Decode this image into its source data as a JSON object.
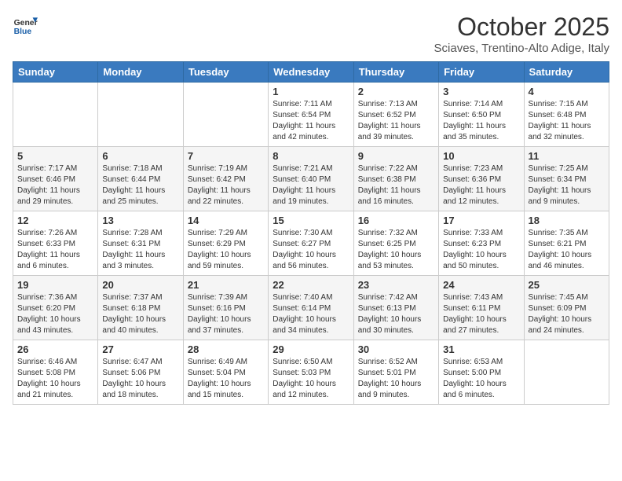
{
  "header": {
    "logo_line1": "General",
    "logo_line2": "Blue",
    "month": "October 2025",
    "location": "Sciaves, Trentino-Alto Adige, Italy"
  },
  "weekdays": [
    "Sunday",
    "Monday",
    "Tuesday",
    "Wednesday",
    "Thursday",
    "Friday",
    "Saturday"
  ],
  "weeks": [
    [
      {
        "day": "",
        "info": ""
      },
      {
        "day": "",
        "info": ""
      },
      {
        "day": "",
        "info": ""
      },
      {
        "day": "1",
        "info": "Sunrise: 7:11 AM\nSunset: 6:54 PM\nDaylight: 11 hours and 42 minutes."
      },
      {
        "day": "2",
        "info": "Sunrise: 7:13 AM\nSunset: 6:52 PM\nDaylight: 11 hours and 39 minutes."
      },
      {
        "day": "3",
        "info": "Sunrise: 7:14 AM\nSunset: 6:50 PM\nDaylight: 11 hours and 35 minutes."
      },
      {
        "day": "4",
        "info": "Sunrise: 7:15 AM\nSunset: 6:48 PM\nDaylight: 11 hours and 32 minutes."
      }
    ],
    [
      {
        "day": "5",
        "info": "Sunrise: 7:17 AM\nSunset: 6:46 PM\nDaylight: 11 hours and 29 minutes."
      },
      {
        "day": "6",
        "info": "Sunrise: 7:18 AM\nSunset: 6:44 PM\nDaylight: 11 hours and 25 minutes."
      },
      {
        "day": "7",
        "info": "Sunrise: 7:19 AM\nSunset: 6:42 PM\nDaylight: 11 hours and 22 minutes."
      },
      {
        "day": "8",
        "info": "Sunrise: 7:21 AM\nSunset: 6:40 PM\nDaylight: 11 hours and 19 minutes."
      },
      {
        "day": "9",
        "info": "Sunrise: 7:22 AM\nSunset: 6:38 PM\nDaylight: 11 hours and 16 minutes."
      },
      {
        "day": "10",
        "info": "Sunrise: 7:23 AM\nSunset: 6:36 PM\nDaylight: 11 hours and 12 minutes."
      },
      {
        "day": "11",
        "info": "Sunrise: 7:25 AM\nSunset: 6:34 PM\nDaylight: 11 hours and 9 minutes."
      }
    ],
    [
      {
        "day": "12",
        "info": "Sunrise: 7:26 AM\nSunset: 6:33 PM\nDaylight: 11 hours and 6 minutes."
      },
      {
        "day": "13",
        "info": "Sunrise: 7:28 AM\nSunset: 6:31 PM\nDaylight: 11 hours and 3 minutes."
      },
      {
        "day": "14",
        "info": "Sunrise: 7:29 AM\nSunset: 6:29 PM\nDaylight: 10 hours and 59 minutes."
      },
      {
        "day": "15",
        "info": "Sunrise: 7:30 AM\nSunset: 6:27 PM\nDaylight: 10 hours and 56 minutes."
      },
      {
        "day": "16",
        "info": "Sunrise: 7:32 AM\nSunset: 6:25 PM\nDaylight: 10 hours and 53 minutes."
      },
      {
        "day": "17",
        "info": "Sunrise: 7:33 AM\nSunset: 6:23 PM\nDaylight: 10 hours and 50 minutes."
      },
      {
        "day": "18",
        "info": "Sunrise: 7:35 AM\nSunset: 6:21 PM\nDaylight: 10 hours and 46 minutes."
      }
    ],
    [
      {
        "day": "19",
        "info": "Sunrise: 7:36 AM\nSunset: 6:20 PM\nDaylight: 10 hours and 43 minutes."
      },
      {
        "day": "20",
        "info": "Sunrise: 7:37 AM\nSunset: 6:18 PM\nDaylight: 10 hours and 40 minutes."
      },
      {
        "day": "21",
        "info": "Sunrise: 7:39 AM\nSunset: 6:16 PM\nDaylight: 10 hours and 37 minutes."
      },
      {
        "day": "22",
        "info": "Sunrise: 7:40 AM\nSunset: 6:14 PM\nDaylight: 10 hours and 34 minutes."
      },
      {
        "day": "23",
        "info": "Sunrise: 7:42 AM\nSunset: 6:13 PM\nDaylight: 10 hours and 30 minutes."
      },
      {
        "day": "24",
        "info": "Sunrise: 7:43 AM\nSunset: 6:11 PM\nDaylight: 10 hours and 27 minutes."
      },
      {
        "day": "25",
        "info": "Sunrise: 7:45 AM\nSunset: 6:09 PM\nDaylight: 10 hours and 24 minutes."
      }
    ],
    [
      {
        "day": "26",
        "info": "Sunrise: 6:46 AM\nSunset: 5:08 PM\nDaylight: 10 hours and 21 minutes."
      },
      {
        "day": "27",
        "info": "Sunrise: 6:47 AM\nSunset: 5:06 PM\nDaylight: 10 hours and 18 minutes."
      },
      {
        "day": "28",
        "info": "Sunrise: 6:49 AM\nSunset: 5:04 PM\nDaylight: 10 hours and 15 minutes."
      },
      {
        "day": "29",
        "info": "Sunrise: 6:50 AM\nSunset: 5:03 PM\nDaylight: 10 hours and 12 minutes."
      },
      {
        "day": "30",
        "info": "Sunrise: 6:52 AM\nSunset: 5:01 PM\nDaylight: 10 hours and 9 minutes."
      },
      {
        "day": "31",
        "info": "Sunrise: 6:53 AM\nSunset: 5:00 PM\nDaylight: 10 hours and 6 minutes."
      },
      {
        "day": "",
        "info": ""
      }
    ]
  ]
}
